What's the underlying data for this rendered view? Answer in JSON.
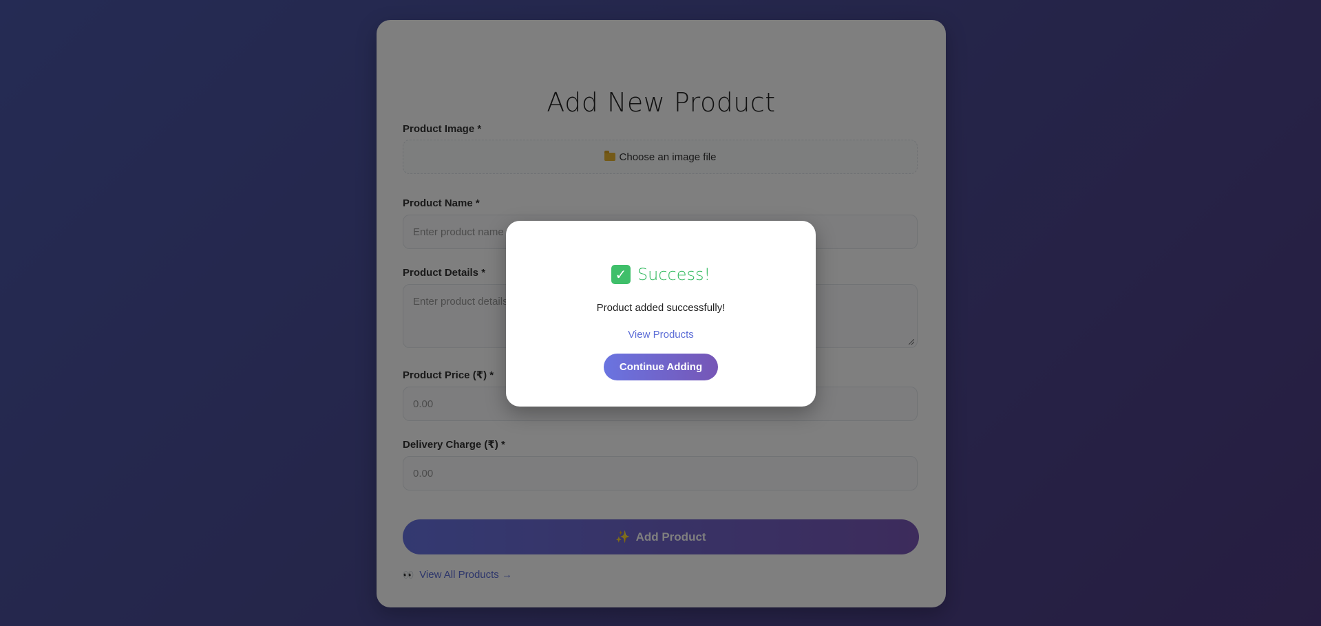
{
  "form": {
    "title": "Add New Product",
    "image_label": "Product Image *",
    "image_button": "Choose an image file",
    "name_label": "Product Name *",
    "name_placeholder": "Enter product name",
    "details_label": "Product Details *",
    "details_placeholder": "Enter product details",
    "price_label": "Product Price (₹) *",
    "price_placeholder": "0.00",
    "delivery_label": "Delivery Charge (₹) *",
    "delivery_placeholder": "0.00",
    "submit_label": "Add Product",
    "view_all_label": "View All Products →"
  },
  "icons": {
    "folder": "folder-icon",
    "sparkle": "sparkles-icon",
    "eyes": "eyes-icon",
    "check": "check-mark-icon"
  },
  "modal": {
    "title": "Success!",
    "message": "Product added successfully!",
    "view_link": "View Products",
    "continue_label": "Continue Adding"
  },
  "colors": {
    "accent": "#6773e2",
    "success": "#2eb85c",
    "link": "#5b6cd6"
  }
}
